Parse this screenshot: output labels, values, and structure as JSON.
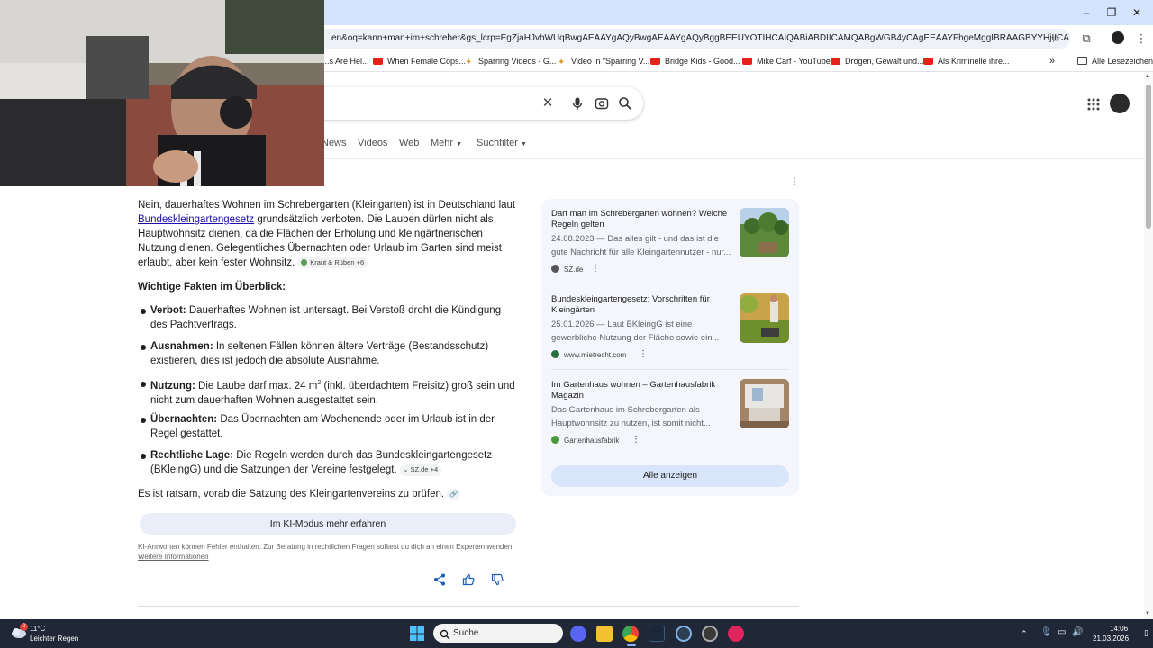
{
  "browser": {
    "url": "en&oq=kann+man+im+schreber&gs_lcrp=EgZjaHJvbWUqBwgAEAAYgAQyBwgAEAAYgAQyBggBEEUYOTIHCAIQABiABDIICAMQABgWGB4yCAgEEAAYFhgeMggIBRAAGBYYHjIICAYQABgWGB4yC...",
    "bookmarks": [
      {
        "label": "...s Are Hel...",
        "icon": "spark"
      },
      {
        "label": "When Female Cops...",
        "icon": "youtube"
      },
      {
        "label": "Sparring Videos - G...",
        "icon": "spark"
      },
      {
        "label": "Video in \"Sparring V...",
        "icon": "spark"
      },
      {
        "label": "Bridge Kids - Good...",
        "icon": "youtube"
      },
      {
        "label": "Mike Carf - YouTube",
        "icon": "youtube"
      },
      {
        "label": "Drogen, Gewalt und...",
        "icon": "youtube"
      },
      {
        "label": "Als Kriminelle ihre...",
        "icon": "youtube"
      }
    ],
    "all_bookmarks_label": "Alle Lesezeichen",
    "more_bookmarks_label": "»"
  },
  "search": {
    "tabs": [
      "News",
      "Videos",
      "Web",
      "Mehr",
      "Suchfilter"
    ]
  },
  "answer": {
    "intro_before_link": "Nein, dauerhaftes Wohnen im Schrebergarten (Kleingarten) ist in Deutschland laut ",
    "intro_link": "Bundeskleingartengesetz",
    "intro_after_link": " grundsätzlich verboten. Die Lauben dürfen nicht als Hauptwohnsitz dienen, da die Flächen der Erholung und kleingärtnerischen Nutzung dienen. Gelegentliches Übernachten oder Urlaub im Garten sind meist erlaubt, aber kein fester Wohnsitz.",
    "intro_chip": "Kraut & Rüben +6",
    "facts_heading": "Wichtige Fakten im Überblick:",
    "bullets": [
      {
        "term": "Verbot:",
        "text": " Dauerhaftes Wohnen ist untersagt. Bei Verstoß droht die Kündigung des Pachtvertrags."
      },
      {
        "term": "Ausnahmen:",
        "text": " In seltenen Fällen können ältere Verträge (Bestandsschutz) existieren, dies ist jedoch die absolute Ausnahme."
      },
      {
        "term": "Nutzung:",
        "text_before": " Die Laube darf max. 24 m",
        "sup": "2",
        "text_after": " (inkl. überdachtem Freisitz) groß sein und nicht zum dauerhaften Wohnen ausgestattet sein."
      },
      {
        "term": "Übernachten:",
        "text": " Das Übernachten am Wochenende oder im Urlaub ist in der Regel gestattet."
      },
      {
        "term": "Rechtliche Lage:",
        "text": " Die Regeln werden durch das Bundeskleingartengesetz (BKleingG) und die Satzungen der Vereine festgelegt.",
        "chip": "SZ.de +4"
      }
    ],
    "closing": "Es ist ratsam, vorab die Satzung des Kleingartenvereins zu prüfen.",
    "ki_button": "Im KI-Modus mehr erfahren",
    "disclaimer": "KI-Antworten können Fehler enthalten. Zur Beratung in rechtlichen Fragen solltest du dich an einen Experten wenden. ",
    "disclaimer_link": "Weitere Informationen"
  },
  "sources": [
    {
      "title": "Darf man im Schrebergarten wohnen? Welche Regeln gelten",
      "snippet": "24.08.2023 — Das alles gilt - und das ist die gute Nachricht für alle Kleingartennutzer - nur...",
      "site": "SZ.de",
      "color": "#555555"
    },
    {
      "title": "Bundeskleingartengesetz: Vorschriften für Kleingärten",
      "snippet": "25.01.2026 — Laut BKleingG ist eine gewerbliche Nutzung der Fläche sowie ein...",
      "site": "www.mietrecht.com",
      "color": "#2b6e3f"
    },
    {
      "title": "Im Gartenhaus wohnen – Gartenhausfabrik Magazin",
      "snippet": "Das Gartenhaus im Schrebergarten als Hauptwohnsitz zu nutzen, ist somit nicht...",
      "site": "Gartenhausfabrik",
      "color": "#4a9a3a"
    }
  ],
  "show_all": "Alle anzeigen",
  "taskbar": {
    "weather_temp": "11°C",
    "weather_desc": "Leichter Regen",
    "weather_badge": "2",
    "search_label": "Suche",
    "time": "14:06",
    "date": "21.03.2026"
  }
}
